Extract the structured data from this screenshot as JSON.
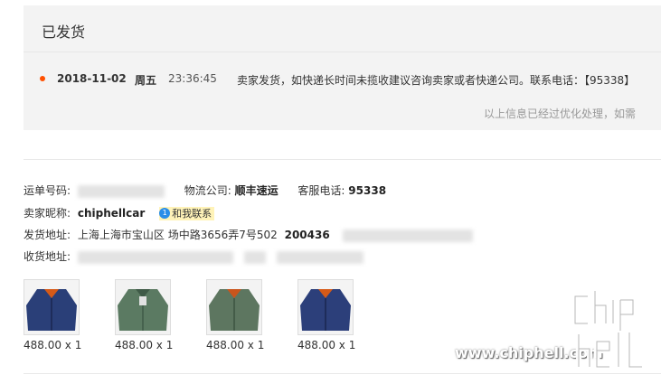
{
  "status": {
    "title": "已发货",
    "track": {
      "date": "2018-11-02",
      "weekday": "周五",
      "time": "23:36:45",
      "message": "卖家发货，如快递长时间未揽收建议咨询卖家或者快递公司。联系电话：【95338】"
    },
    "notice": "以上信息已经过优化处理，如需"
  },
  "info": {
    "waybill_label": "运单号码:",
    "carrier_label": "物流公司:",
    "carrier_value": "顺丰速运",
    "service_label": "客服电话:",
    "service_value": "95338",
    "seller_label": "卖家昵称:",
    "seller_value": "chiphellcar",
    "contact_label": "和我联系",
    "ship_label": "发货地址:",
    "ship_value": "上海上海市宝山区 场中路3656弄7号502",
    "ship_zip": "200436",
    "recv_label": "收货地址:"
  },
  "products": [
    {
      "color": "#2a3f78",
      "price": "488.00 x 1"
    },
    {
      "color": "#5b7a62",
      "price": "488.00 x 1"
    },
    {
      "color": "#5d7660",
      "price": "488.00 x 1"
    },
    {
      "color": "#2c3f7a",
      "price": "488.00 x 1"
    }
  ],
  "watermark": "www.chiphell.com"
}
